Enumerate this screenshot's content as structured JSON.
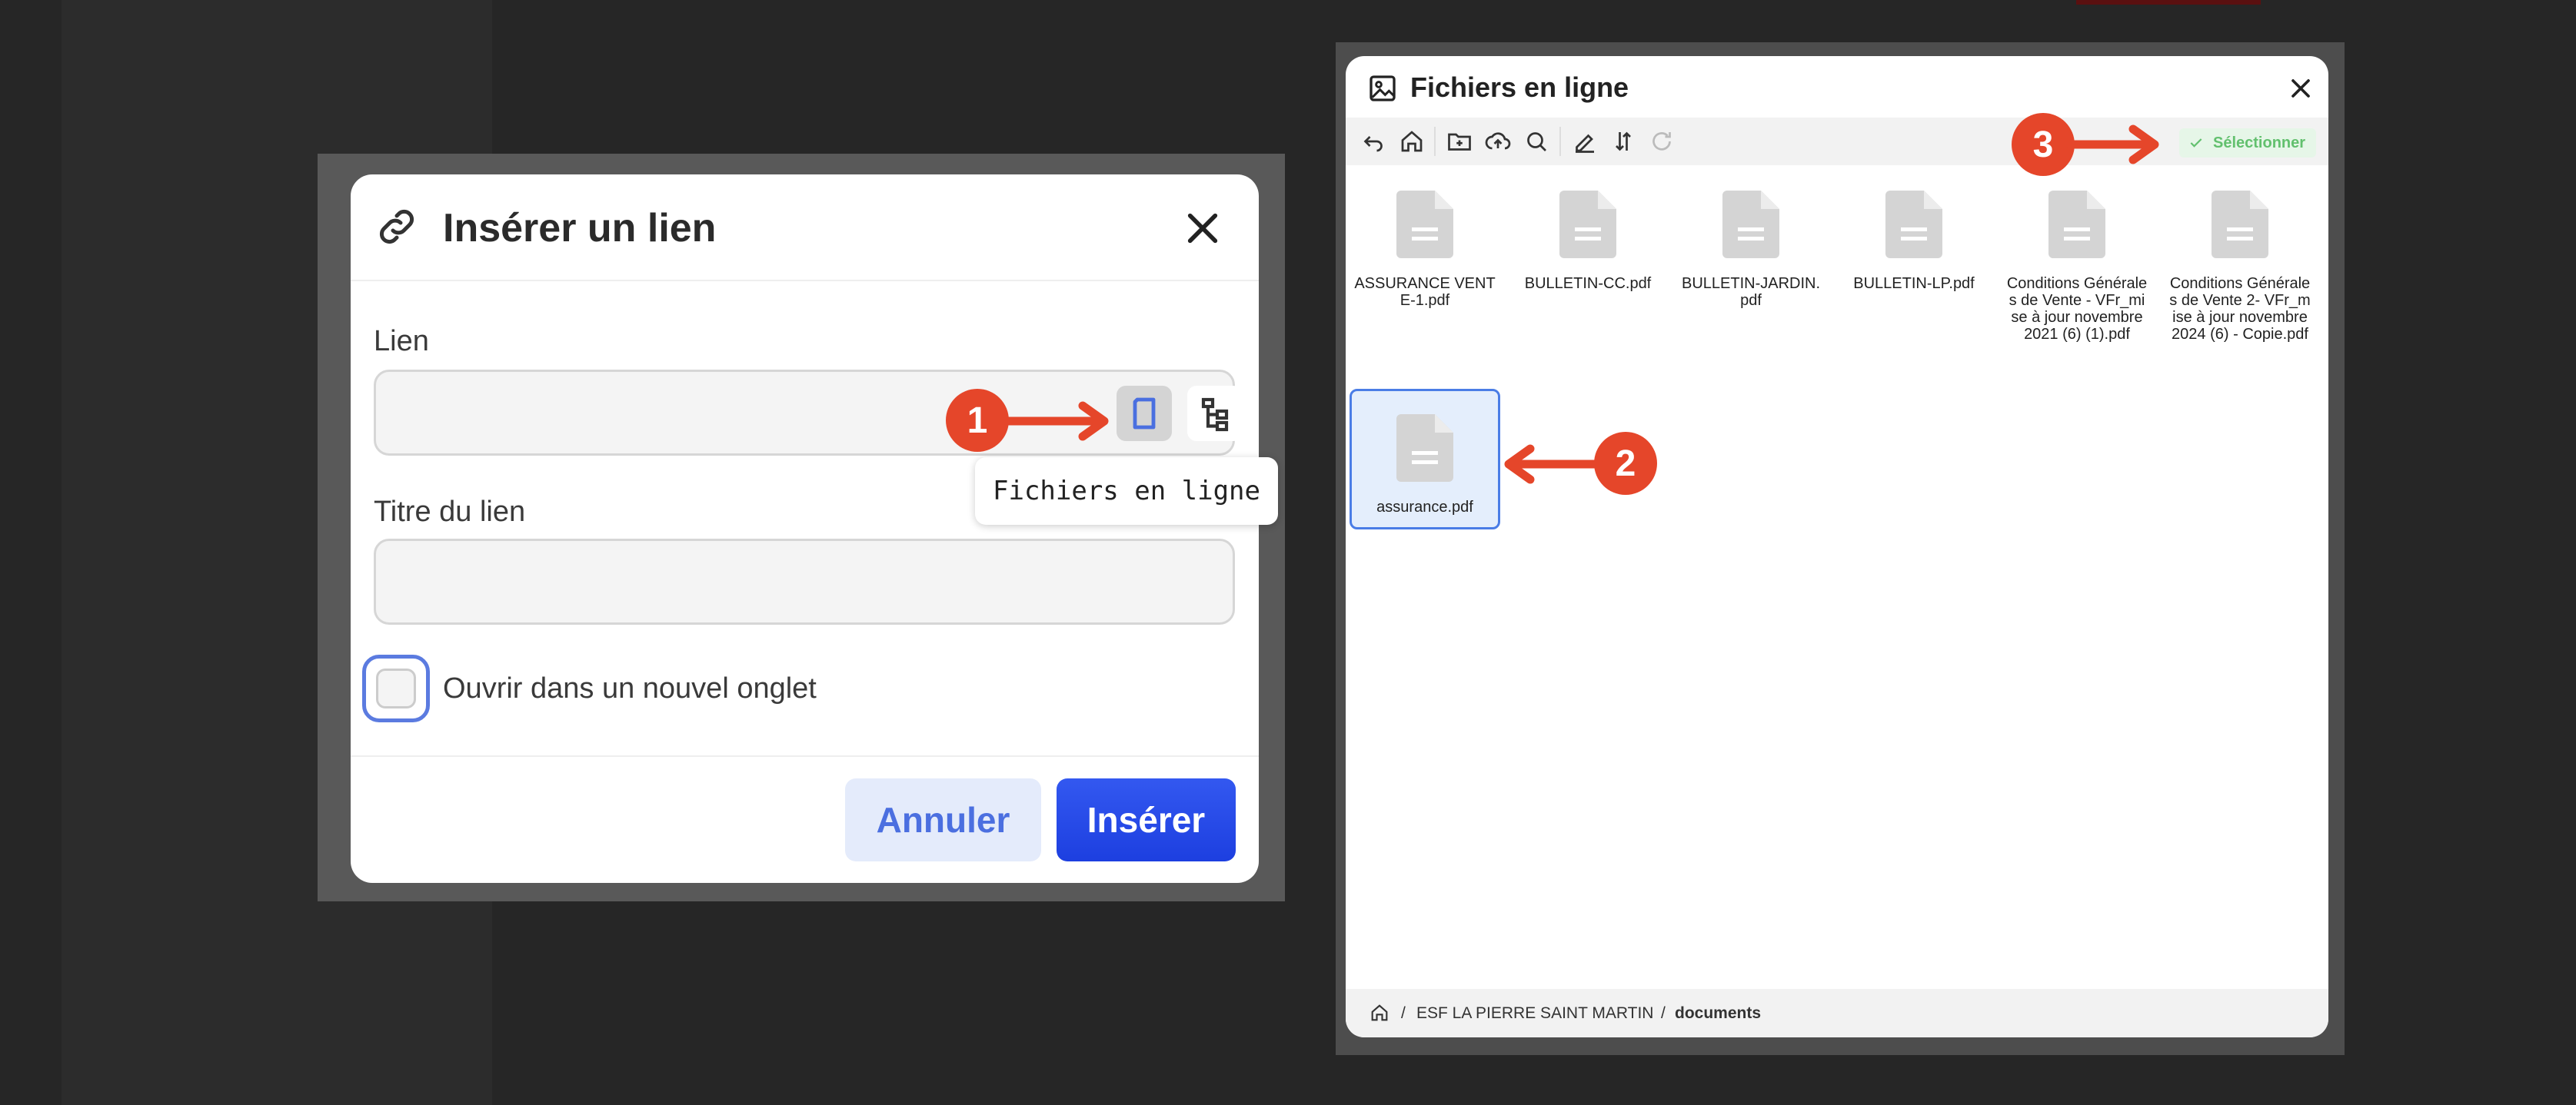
{
  "link_dialog": {
    "title": "Insérer un lien",
    "link_label": "Lien",
    "link_value": "",
    "title_label": "Titre du lien",
    "title_value": "",
    "new_tab_label": "Ouvrir dans un nouvel onglet",
    "cancel_label": "Annuler",
    "insert_label": "Insérer",
    "tooltip": "Fichiers en ligne"
  },
  "annotations": {
    "step1": "1",
    "step2": "2",
    "step3": "3",
    "color": "#e5462a"
  },
  "file_manager": {
    "title": "Fichiers en ligne",
    "select_label": "Sélectionner",
    "files": [
      {
        "name": "ASSURANCE VENTE-1.pdf"
      },
      {
        "name": "BULLETIN-CC.pdf"
      },
      {
        "name": "BULLETIN-JARDIN.pdf"
      },
      {
        "name": "BULLETIN-LP.pdf"
      },
      {
        "name": "Conditions Générales de Vente - VFr_mise à jour novembre 2021 (6) (1).pdf"
      },
      {
        "name": "Conditions Générales de Vente 2- VFr_mise à jour novembre 2024 (6) - Copie.pdf"
      },
      {
        "name": "assurance.pdf",
        "selected": true
      }
    ],
    "breadcrumb": {
      "sep": "/",
      "root": "ESF LA PIERRE SAINT MARTIN",
      "current": "documents"
    }
  },
  "colors": {
    "primary": "#1d3fe0",
    "accent_green": "#62c06e",
    "selection": "#4a7de6"
  }
}
